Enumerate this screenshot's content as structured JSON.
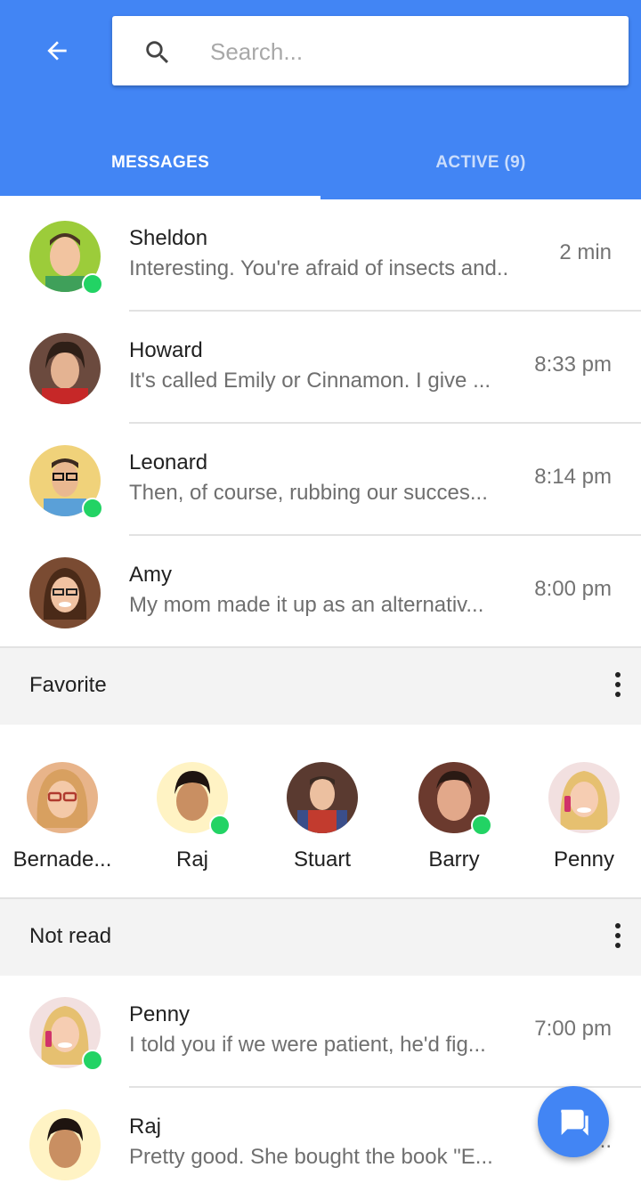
{
  "search": {
    "placeholder": "Search..."
  },
  "tabs": [
    {
      "label": "MESSAGES",
      "active": true
    },
    {
      "label": "ACTIVE (9)",
      "active": false
    }
  ],
  "messages": [
    {
      "name": "Sheldon",
      "preview": "Interesting. You're afraid of insects and..",
      "time": "2 min",
      "online": true
    },
    {
      "name": "Howard",
      "preview": "It's called Emily or Cinnamon. I give ...",
      "time": "8:33 pm",
      "online": false
    },
    {
      "name": "Leonard",
      "preview": "Then, of course, rubbing our succes...",
      "time": "8:14 pm",
      "online": true
    },
    {
      "name": "Amy",
      "preview": "My mom made it up as an alternativ...",
      "time": "8:00 pm",
      "online": false
    }
  ],
  "favorite": {
    "title": "Favorite",
    "people": [
      {
        "name": "Bernade...",
        "online": false
      },
      {
        "name": "Raj",
        "online": true
      },
      {
        "name": "Stuart",
        "online": false
      },
      {
        "name": "Barry",
        "online": true
      },
      {
        "name": "Penny",
        "online": false
      }
    ]
  },
  "not_read": {
    "title": "Not read",
    "messages": [
      {
        "name": "Penny",
        "preview": "I told you if we were patient, he'd fig...",
        "time": "7:00 pm",
        "online": true
      },
      {
        "name": "Raj",
        "preview": "Pretty good. She bought the book \"E...",
        "time": "6:...",
        "online": false
      }
    ]
  },
  "colors": {
    "primary": "#4285f4",
    "online": "#22d364"
  },
  "icons": {
    "back": "arrow-back-icon",
    "search": "search-icon",
    "menu": "more-vert-icon",
    "fab": "chat-icon"
  }
}
